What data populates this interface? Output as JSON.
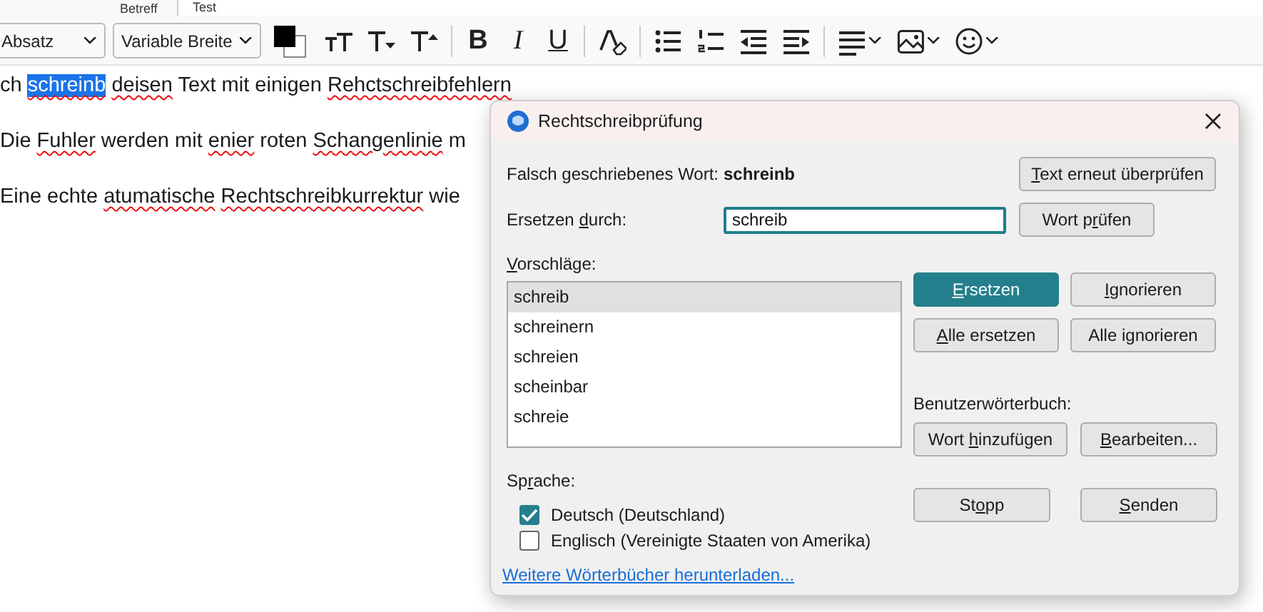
{
  "header": {
    "label": "Betreff",
    "value": "Test"
  },
  "toolbar": {
    "paragraph_format": "Absatz",
    "font": "Variable Breite",
    "buttons": [
      {
        "kind": "smaller"
      },
      {
        "kind": "size-down"
      },
      {
        "kind": "size-up"
      },
      {
        "kind": "sep"
      },
      {
        "kind": "bold",
        "text": "B"
      },
      {
        "kind": "italic",
        "text": "I"
      },
      {
        "kind": "underline",
        "text": "U"
      },
      {
        "kind": "sep"
      },
      {
        "kind": "clear"
      },
      {
        "kind": "sep"
      },
      {
        "kind": "bullets"
      },
      {
        "kind": "numbers"
      },
      {
        "kind": "outdent"
      },
      {
        "kind": "indent"
      },
      {
        "kind": "sep"
      },
      {
        "kind": "align"
      },
      {
        "kind": "image"
      },
      {
        "kind": "emoji"
      }
    ]
  },
  "editor": {
    "paragraphs": [
      [
        {
          "text": "ch ",
          "misspelled": false,
          "selected": false
        },
        {
          "text": "schreinb",
          "misspelled": true,
          "selected": true
        },
        {
          "text": " deisen",
          "misspelled": true,
          "selected": false
        },
        {
          "text": " Text mit einigen ",
          "misspelled": false,
          "selected": false
        },
        {
          "text": "Rehctschreibfehlern",
          "misspelled": true,
          "selected": false
        }
      ],
      [
        {
          "text": "Die ",
          "misspelled": false,
          "selected": false
        },
        {
          "text": "Fuhler",
          "misspelled": true,
          "selected": false
        },
        {
          "text": " werden mit ",
          "misspelled": false,
          "selected": false
        },
        {
          "text": "enier",
          "misspelled": true,
          "selected": false
        },
        {
          "text": " roten ",
          "misspelled": false,
          "selected": false
        },
        {
          "text": "Schangenlinie",
          "misspelled": true,
          "selected": false
        },
        {
          "text": " m",
          "misspelled": false,
          "selected": false
        }
      ],
      [
        {
          "text": "Eine echte ",
          "misspelled": false,
          "selected": false
        },
        {
          "text": "atumatische",
          "misspelled": true,
          "selected": false
        },
        {
          "text": " Rechtschreibkurrektur",
          "misspelled": true,
          "selected": false
        },
        {
          "text": " wie",
          "misspelled": false,
          "selected": false
        }
      ]
    ]
  },
  "dialog": {
    "title": "Rechtschreibprüfung",
    "misspelled_label": "Falsch geschriebenes Wort:",
    "misspelled_word": "schreinb",
    "recheck_button": [
      {
        "text": "T",
        "underlined": true
      },
      {
        "text": "ext erneut überprüfen",
        "underlined": false
      }
    ],
    "replace_label": [
      {
        "text": "Ersetzen ",
        "underlined": false
      },
      {
        "text": "d",
        "underlined": true
      },
      {
        "text": "urch:",
        "underlined": false
      }
    ],
    "replace_value": "schreib",
    "check_word_button": [
      {
        "text": "Wort p",
        "underlined": false
      },
      {
        "text": "r",
        "underlined": true
      },
      {
        "text": "üfen",
        "underlined": false
      }
    ],
    "suggestions_label": [
      {
        "text": "V",
        "underlined": true
      },
      {
        "text": "orschläge:",
        "underlined": false
      }
    ],
    "suggestions": [
      {
        "text": "schreib",
        "selected": true
      },
      {
        "text": "schreinern",
        "selected": false
      },
      {
        "text": "schreien",
        "selected": false
      },
      {
        "text": "scheinbar",
        "selected": false
      },
      {
        "text": "schreie",
        "selected": false
      }
    ],
    "action_buttons": [
      {
        "primary": true,
        "label": [
          {
            "text": "E",
            "underlined": true
          },
          {
            "text": "rsetzen",
            "underlined": false
          }
        ]
      },
      {
        "primary": false,
        "label": [
          {
            "text": "I",
            "underlined": true
          },
          {
            "text": "gnorieren",
            "underlined": false
          }
        ]
      },
      {
        "primary": false,
        "label": [
          {
            "text": "A",
            "underlined": true
          },
          {
            "text": "lle ersetzen",
            "underlined": false
          }
        ]
      },
      {
        "primary": false,
        "label": [
          {
            "text": "Alle ignorieren",
            "underlined": false
          }
        ]
      }
    ],
    "user_dictionary_label": "Benutzerwörterbuch:",
    "dictionary_buttons": [
      {
        "label": [
          {
            "text": "Wort ",
            "underlined": false
          },
          {
            "text": "h",
            "underlined": true
          },
          {
            "text": "inzufügen",
            "underlined": false
          }
        ]
      },
      {
        "label": [
          {
            "text": "B",
            "underlined": true
          },
          {
            "text": "earbeiten...",
            "underlined": false
          }
        ]
      }
    ],
    "language_label": [
      {
        "text": "Sp",
        "underlined": false
      },
      {
        "text": "r",
        "underlined": true
      },
      {
        "text": "ache:",
        "underlined": false
      }
    ],
    "languages": [
      {
        "label": "Deutsch (Deutschland)",
        "checked": true
      },
      {
        "label": "Englisch (Vereinigte Staaten von Amerika)",
        "checked": false
      }
    ],
    "bottom_buttons": [
      {
        "label": [
          {
            "text": "St",
            "underlined": false
          },
          {
            "text": "o",
            "underlined": true
          },
          {
            "text": "pp",
            "underlined": false
          }
        ]
      },
      {
        "label": [
          {
            "text": "S",
            "underlined": true
          },
          {
            "text": "enden",
            "underlined": false
          }
        ]
      }
    ],
    "download_link": "Weitere Wörterbücher herunterladen..."
  }
}
